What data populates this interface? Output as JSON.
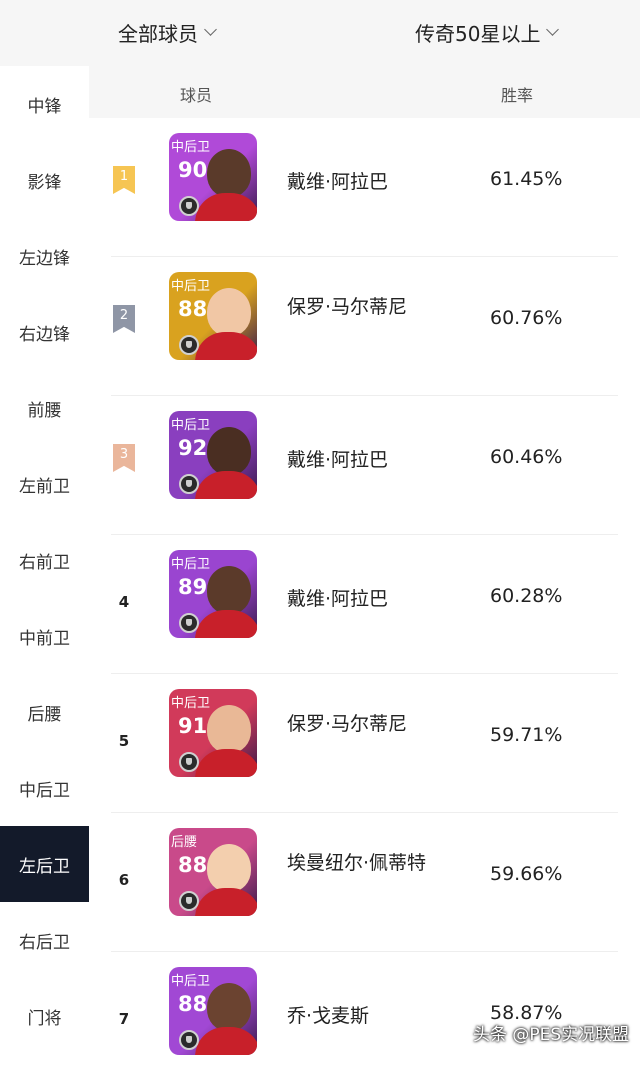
{
  "filters": {
    "group": "全部球员",
    "tier": "传奇50星以上"
  },
  "sidebar": {
    "items": [
      {
        "label": "中锋"
      },
      {
        "label": "影锋"
      },
      {
        "label": "左边锋"
      },
      {
        "label": "右边锋"
      },
      {
        "label": "前腰"
      },
      {
        "label": "左前卫"
      },
      {
        "label": "右前卫"
      },
      {
        "label": "中前卫"
      },
      {
        "label": "后腰"
      },
      {
        "label": "中后卫"
      },
      {
        "label": "左后卫"
      },
      {
        "label": "右后卫"
      },
      {
        "label": "门将"
      }
    ],
    "active": "左后卫"
  },
  "table": {
    "headers": {
      "player": "球员",
      "win_rate": "胜率"
    },
    "rows": [
      {
        "rank": "1",
        "medal": "gold",
        "card_pos": "中后卫",
        "card_rating": "90",
        "card_color": "#b04ad8",
        "name": "戴维·阿拉巴",
        "win_rate": "61.45%"
      },
      {
        "rank": "2",
        "medal": "silver",
        "card_pos": "中后卫",
        "card_rating": "88",
        "card_color": "#d9a21f",
        "name": "保罗·马尔蒂尼",
        "win_rate": "60.76%"
      },
      {
        "rank": "3",
        "medal": "bronze",
        "card_pos": "中后卫",
        "card_rating": "92",
        "card_color": "#8a3fbf",
        "name": "戴维·阿拉巴",
        "win_rate": "60.46%"
      },
      {
        "rank": "4",
        "medal": "",
        "card_pos": "中后卫",
        "card_rating": "89",
        "card_color": "#9a45d0",
        "name": "戴维·阿拉巴",
        "win_rate": "60.28%"
      },
      {
        "rank": "5",
        "medal": "",
        "card_pos": "中后卫",
        "card_rating": "91",
        "card_color": "#d13a5a",
        "name": "保罗·马尔蒂尼",
        "win_rate": "59.71%"
      },
      {
        "rank": "6",
        "medal": "",
        "card_pos": "后腰",
        "card_rating": "88",
        "card_color": "#c94a8a",
        "name": "埃曼纽尔·佩蒂特",
        "win_rate": "59.66%"
      },
      {
        "rank": "7",
        "medal": "",
        "card_pos": "中后卫",
        "card_rating": "88",
        "card_color": "#a148d4",
        "name": "乔·戈麦斯",
        "win_rate": "58.87%"
      }
    ]
  },
  "watermark": "头条 @PES实况联盟"
}
